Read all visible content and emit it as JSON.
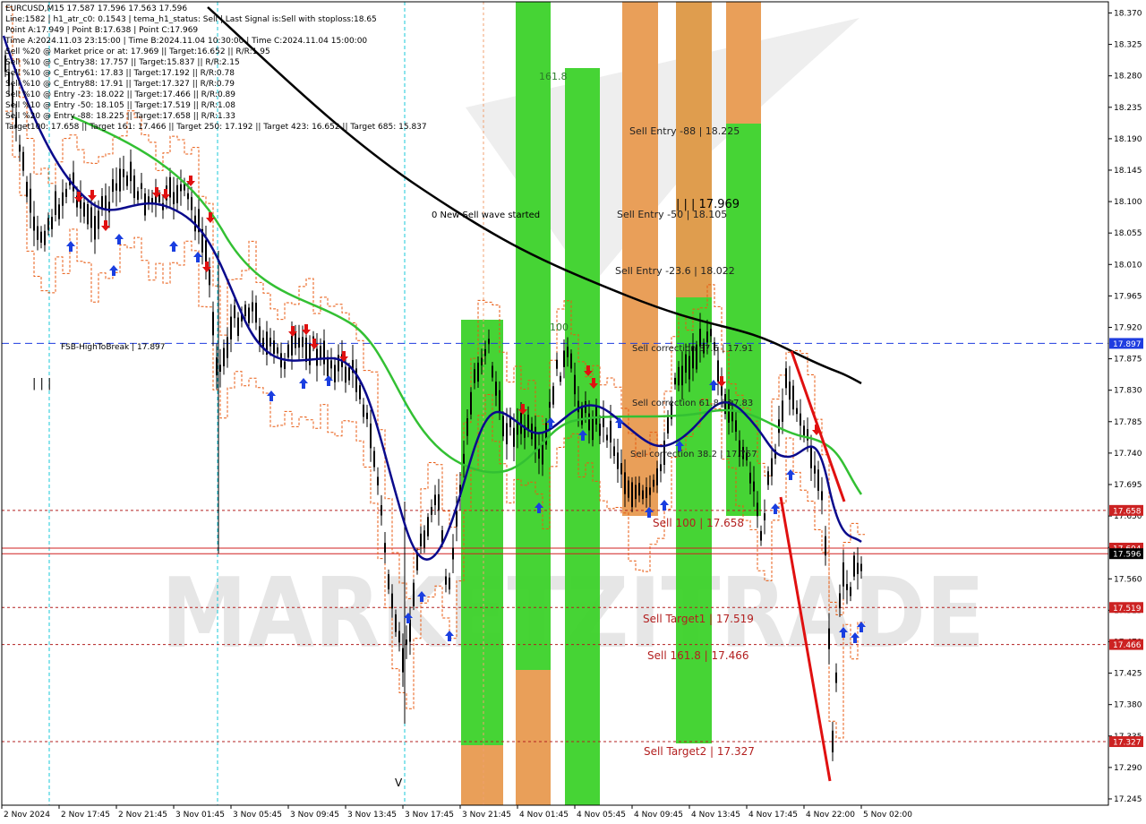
{
  "chart_data": {
    "type": "line",
    "title": "EURCUSD,M15  17.587 17.596 17.563 17.596",
    "info_lines": [
      "Line:1582 | h1_atr_c0: 0.1543 | tema_h1_status: Sell | Last Signal is:Sell with stoploss:18.65",
      "Point A:17.949 | Point B:17.638 | Point C:17.969",
      "Time A:2024.11.03 23:15:00 | Time B:2024.11.04 10:30:00 | Time C:2024.11.04 15:00:00",
      "Sell %20 @ Market price or at: 17.969 || Target:16.652 || R/R:1.95",
      "Sell %10 @ C_Entry38: 17.757 || Target:15.837 || R/R:2.15",
      "Sell %10 @ C_Entry61: 17.83 || Target:17.192 || R/R:0.78",
      "Sell %10 @ C_Entry88: 17.91 || Target:17.327 || R/R:0.79",
      "Sell %10 @ Entry -23: 18.022 || Target:17.466 || R/R:0.89",
      "Sell %10 @ Entry -50: 18.105 || Target:17.519 || R/R:1.08",
      "Sell %20 @ Entry -88: 18.225 || Target:17.658 || R/R:1.33",
      "Target100: 17.658 || Target 161: 17.466 || Target 250: 17.192 || Target 423: 16.652 || Target 685: 15.837"
    ],
    "y_ticks": [
      "18.370",
      "18.325",
      "18.280",
      "18.235",
      "18.190",
      "18.145",
      "18.100",
      "18.055",
      "18.010",
      "17.965",
      "17.920",
      "17.875",
      "17.830",
      "17.785",
      "17.740",
      "17.695",
      "17.650",
      "17.605",
      "17.560",
      "17.515",
      "17.470",
      "17.425",
      "17.380",
      "17.335",
      "17.290",
      "17.245"
    ],
    "ylim": [
      17.236,
      18.386
    ],
    "x_ticks": [
      "2 Nov 2024",
      "2 Nov 17:45",
      "2 Nov 21:45",
      "3 Nov 01:45",
      "3 Nov 05:45",
      "3 Nov 09:45",
      "3 Nov 13:45",
      "3 Nov 17:45",
      "3 Nov 21:45",
      "4 Nov 01:45",
      "4 Nov 05:45",
      "4 Nov 09:45",
      "4 Nov 13:45",
      "4 Nov 17:45",
      "4 Nov 22:00",
      "5 Nov 02:00"
    ],
    "price_tags": [
      {
        "label": "17.897",
        "value": 17.897,
        "color": "#1f3de0"
      },
      {
        "label": "17.658",
        "value": 17.658,
        "color": "#cc2222"
      },
      {
        "label": "17.604",
        "value": 17.604,
        "color": "#cc2222"
      },
      {
        "label": "17.596",
        "value": 17.596,
        "color": "#000000"
      },
      {
        "label": "17.519",
        "value": 17.519,
        "color": "#cc2222"
      },
      {
        "label": "17.466",
        "value": 17.466,
        "color": "#cc2222"
      },
      {
        "label": "17.327",
        "value": 17.327,
        "color": "#cc2222"
      }
    ],
    "hlines": [
      {
        "value": 17.897,
        "color": "#1f3de0",
        "style": "dash"
      },
      {
        "value": 17.658,
        "color": "#b32020",
        "style": "dot"
      },
      {
        "value": 17.604,
        "color": "#d02020",
        "style": "solid"
      },
      {
        "value": 17.596,
        "color": "#d02020",
        "style": "solid"
      },
      {
        "value": 17.519,
        "color": "#b32020",
        "style": "dot"
      },
      {
        "value": 17.466,
        "color": "#b32020",
        "style": "dot"
      },
      {
        "value": 17.327,
        "color": "#b32020",
        "style": "dot"
      }
    ],
    "annotations": [
      {
        "text": "FSB-HighToBreak | 17.897",
        "color": "#000000"
      },
      {
        "text": "0 New Sell wave started",
        "color": "#000000"
      },
      {
        "text": "Sell Entry -88 | 18.225",
        "color": "#222222"
      },
      {
        "text": "Sell Entry -50 | 18.105",
        "color": "#222222"
      },
      {
        "text": "Sell Entry -23.6 | 18.022",
        "color": "#222222"
      },
      {
        "text": "Sell correction 87.5 | 17.91",
        "color": "#222222"
      },
      {
        "text": "Sell correction 61.8 | 17.83",
        "color": "#222222"
      },
      {
        "text": "Sell correction 38.2 | 17.757",
        "color": "#222222"
      },
      {
        "text": "Sell 100 | 17.658",
        "color": "#b32020"
      },
      {
        "text": "Sell Target1 | 17.519",
        "color": "#b32020"
      },
      {
        "text": "Sell 161.8 | 17.466",
        "color": "#b32020"
      },
      {
        "text": "Sell Target2 | 17.327",
        "color": "#b32020"
      },
      {
        "text": "| | | 17.969",
        "color": "#000000"
      },
      {
        "text": "161.8",
        "color": "#2a7a2a"
      },
      {
        "text": "100",
        "color": "#2a7a2a"
      }
    ],
    "watermark": "MARKETZITRADE",
    "colors": {
      "ma_black": "#000000",
      "ma_green": "#33c033",
      "ma_navy": "#0a0a8c",
      "zone_green": "#3cd22a",
      "zone_orange": "#e89a50",
      "red_line": "#e01010",
      "orange_dash": "#e85a10",
      "cyan_vline": "#18c8d8",
      "buy_arrow": "#1a3ee0",
      "sell_arrow": "#e01010"
    }
  }
}
